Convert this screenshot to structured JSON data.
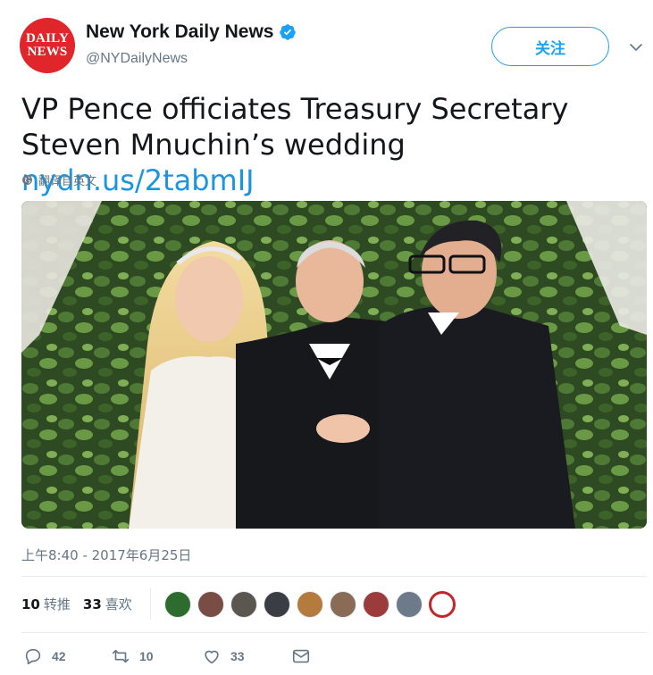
{
  "account": {
    "avatar_line1": "DAILY",
    "avatar_line2": "NEWS",
    "display_name": "New York Daily News",
    "handle": "@NYDailyNews",
    "verified_icon": "verified-badge-icon"
  },
  "follow_button": {
    "label": "关注"
  },
  "tweet": {
    "text": "VP Pence officiates Treasury Secretary Steven Mnuchin’s wedding ",
    "link": "nydn.us/2tabmIJ",
    "translate_label": "翻译自英文",
    "timestamp": "上午8:40 - 2017年6月25日"
  },
  "stats": {
    "retweets_count": "10",
    "retweets_label": "转推",
    "likes_count": "33",
    "likes_label": "喜欢"
  },
  "actions": {
    "reply_count": "42",
    "retweet_count": "10",
    "like_count": "33"
  },
  "colors": {
    "accent": "#1da1f2",
    "link": "#1b95e0",
    "muted": "#657786",
    "brand_red": "#e0262b"
  }
}
